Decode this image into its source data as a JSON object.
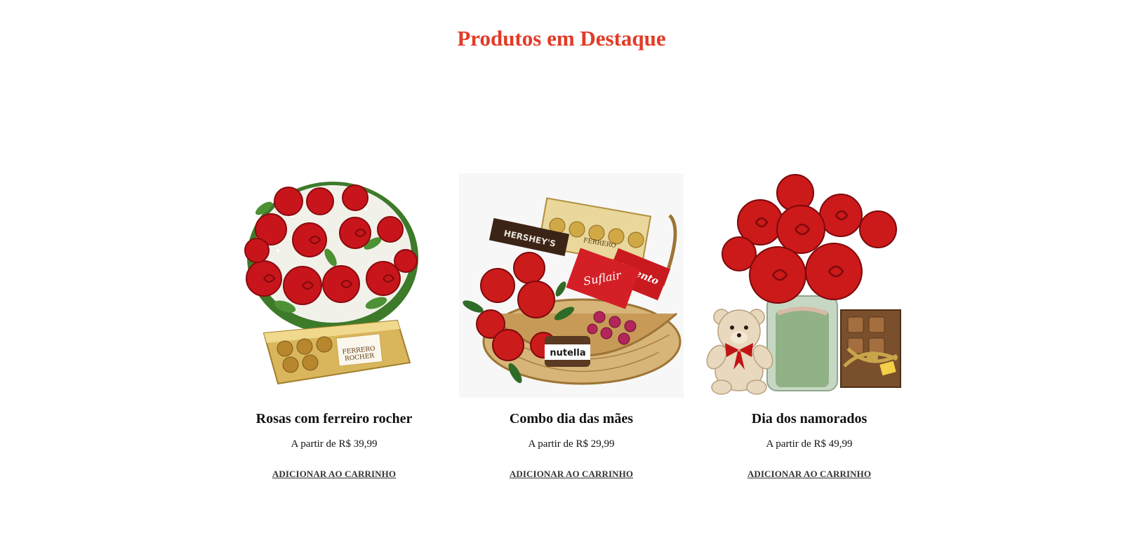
{
  "section": {
    "title": "Produtos em Destaque"
  },
  "colors": {
    "title": "#e23b27",
    "rose": "#c8151b",
    "gold": "#c9a54a"
  },
  "products": [
    {
      "name": "Rosas com ferreiro rocher",
      "price": "A partir de R$ 39,99",
      "cta": "ADICIONAR AO CARRINHO",
      "image": "bouquet-with-ferrero-box"
    },
    {
      "name": "Combo dia das mães",
      "price": "A partir de R$ 29,99",
      "cta": "ADICIONAR AO CARRINHO",
      "image": "gift-basket-flowers-chocolates",
      "image_labels": [
        "HERSHEY'S",
        "Talento",
        "Suflair",
        "nutella",
        "FERRERO"
      ]
    },
    {
      "name": "Dia dos namorados",
      "price": "A partir de R$ 49,99",
      "cta": "ADICIONAR AO CARRINHO",
      "image": "roses-vase-teddy-bear-chocolate-box"
    }
  ]
}
